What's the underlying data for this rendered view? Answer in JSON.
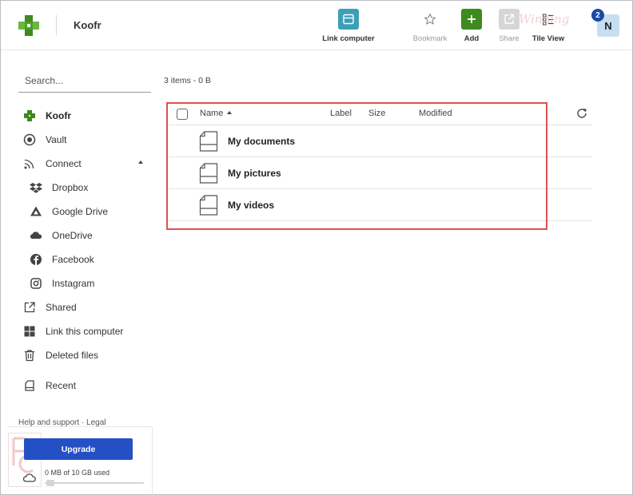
{
  "topbar": {
    "brand": "Koofr",
    "actions": [
      {
        "label": "Link computer",
        "icon": "link-computer-icon",
        "enabled": true
      },
      {
        "label": "Bookmark",
        "icon": "star-icon",
        "enabled": false
      },
      {
        "label": "Add",
        "icon": "plus-icon",
        "enabled": true
      },
      {
        "label": "Share",
        "icon": "share-icon",
        "enabled": false
      },
      {
        "label": "Tile View",
        "icon": "tile-view-icon",
        "enabled": true
      }
    ],
    "avatar_initial": "N",
    "notification_count": "2",
    "watermark": "Winning"
  },
  "sidebar": {
    "search_placeholder": "Search...",
    "items": [
      {
        "label": "Koofr",
        "icon": "koofr-icon",
        "active": true
      },
      {
        "label": "Vault",
        "icon": "vault-icon"
      },
      {
        "label": "Connect",
        "icon": "rss-icon",
        "expanded": true
      },
      {
        "label": "Dropbox",
        "icon": "dropbox-icon"
      },
      {
        "label": "Google Drive",
        "icon": "google-drive-icon"
      },
      {
        "label": "OneDrive",
        "icon": "onedrive-icon"
      },
      {
        "label": "Facebook",
        "icon": "facebook-icon"
      },
      {
        "label": "Instagram",
        "icon": "instagram-icon"
      },
      {
        "label": "Shared",
        "icon": "shared-icon"
      },
      {
        "label": "Link this computer",
        "icon": "windows-icon"
      },
      {
        "label": "Deleted files",
        "icon": "trash-icon"
      },
      {
        "label": "Recent",
        "icon": "recent-icon"
      }
    ],
    "footer_links": "Help and support · Legal",
    "upgrade_label": "Upgrade",
    "storage_text": "0 MB of 10 GB used",
    "storage_used_fraction": 0
  },
  "main": {
    "item_count": "3 items - 0 B",
    "columns": {
      "name": "Name",
      "label": "Label",
      "size": "Size",
      "modified": "Modified"
    },
    "sort": {
      "column": "Name",
      "direction": "ascending"
    },
    "files": [
      {
        "name": "My documents"
      },
      {
        "name": "My pictures"
      },
      {
        "name": "My videos"
      }
    ]
  },
  "colors": {
    "brand_green": "#3d8a1e",
    "link_computer_teal": "#3d9fb6",
    "upgrade_blue": "#2450c5",
    "badge_blue": "#1b4aa6",
    "highlight_red": "#e05050"
  }
}
